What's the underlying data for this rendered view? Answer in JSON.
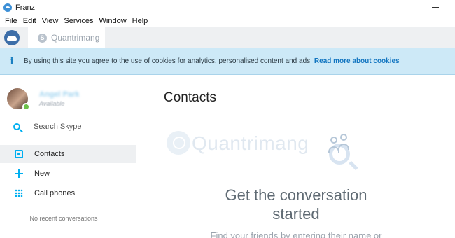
{
  "window": {
    "title": "Franz"
  },
  "menu": {
    "items": [
      "File",
      "Edit",
      "View",
      "Services",
      "Window",
      "Help"
    ]
  },
  "tabs": [
    {
      "label": "Quantrimang",
      "icon": "skype-icon"
    }
  ],
  "cookie_banner": {
    "text": "By using this site you agree to the use of cookies for analytics, personalised content and ads.",
    "link": "Read more about cookies",
    "icon": "info-icon"
  },
  "profile": {
    "name": "Angel Park",
    "status": "Available",
    "presence_color": "#6cc04a"
  },
  "sidebar": {
    "search_label": "Search Skype",
    "nav": [
      {
        "label": "Contacts",
        "icon": "contacts-icon",
        "active": true
      },
      {
        "label": "New",
        "icon": "plus-icon",
        "active": false
      },
      {
        "label": "Call phones",
        "icon": "dialpad-icon",
        "active": false
      }
    ],
    "empty_text": "No recent conversations"
  },
  "main": {
    "title": "Contacts",
    "watermark": "Quantrimang",
    "cta_title": "Get the conversation started",
    "cta_sub": "Find your friends by entering their name or"
  },
  "colors": {
    "accent": "#00aff0",
    "banner": "#cde9f7",
    "link": "#1275c0"
  }
}
